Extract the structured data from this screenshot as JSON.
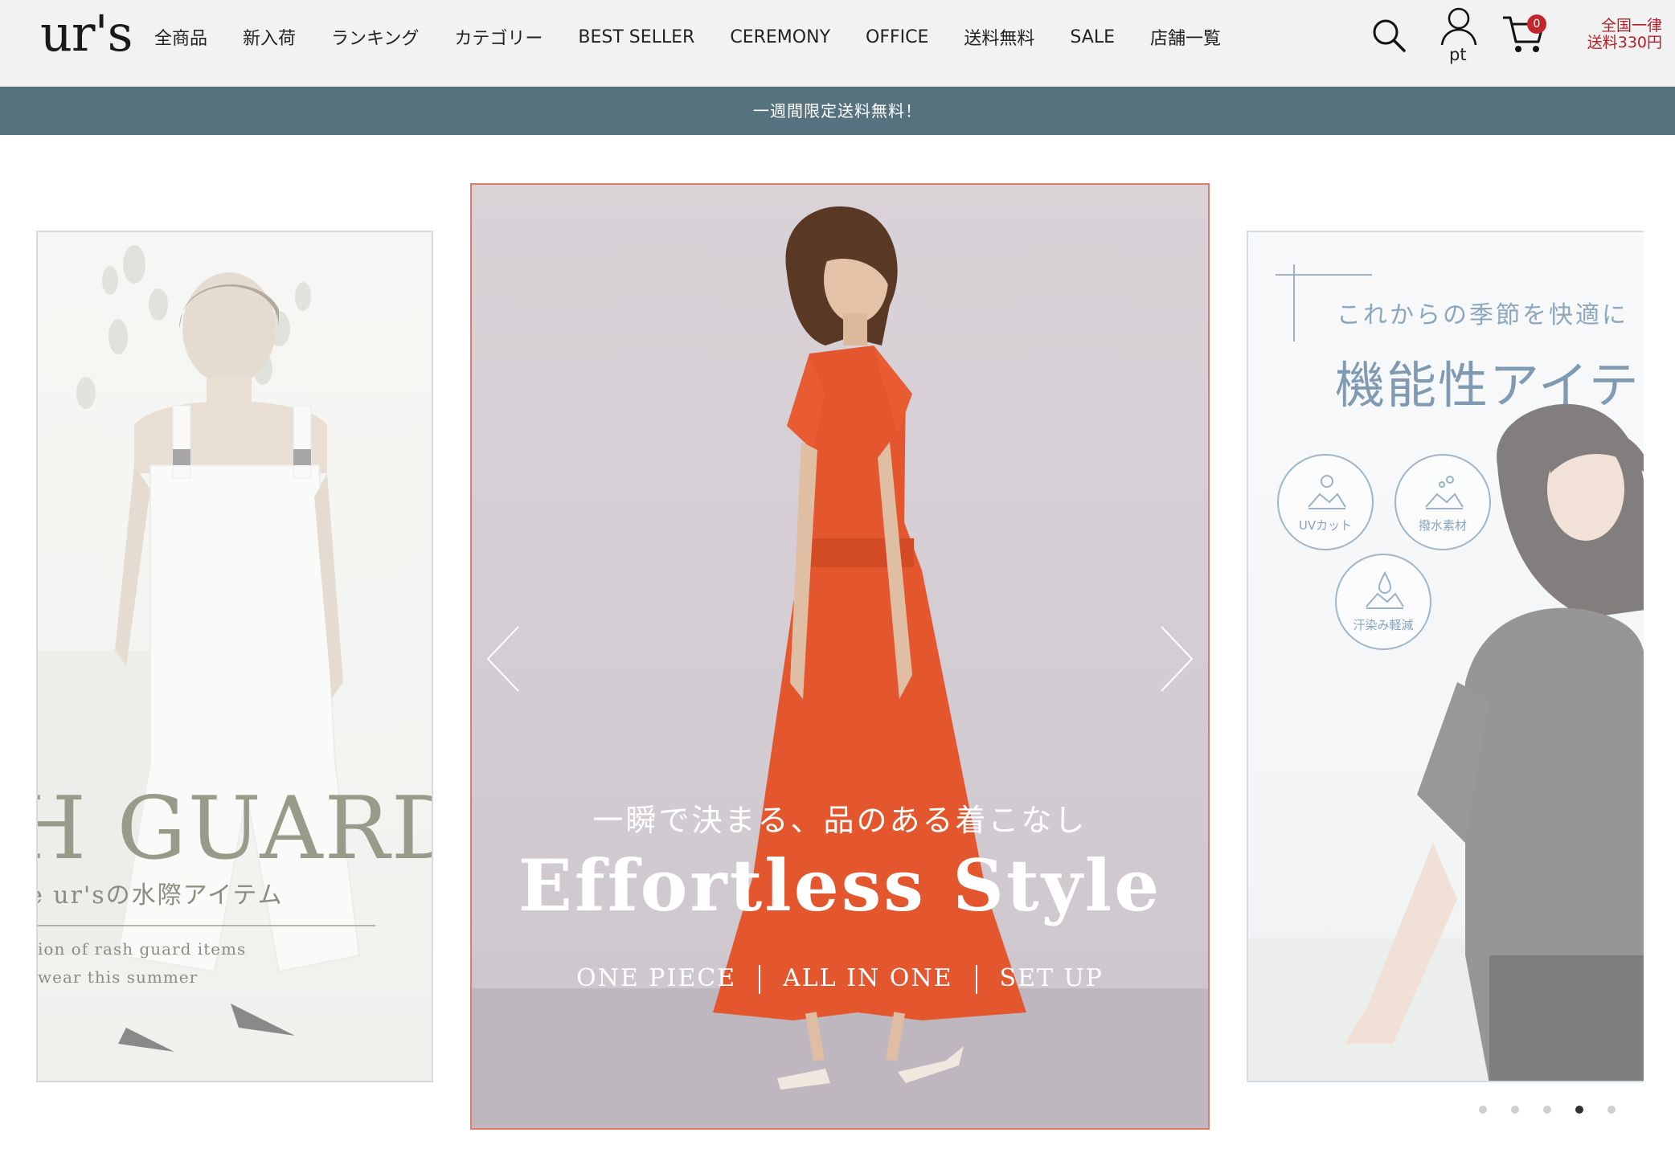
{
  "header": {
    "logo": "ur's",
    "nav": [
      "全商品",
      "新入荷",
      "ランキング",
      "カテゴリー",
      "BEST SELLER",
      "CEREMONY",
      "OFFICE",
      "送料無料",
      "SALE",
      "店舗一覧"
    ],
    "points_label": "pt",
    "cart_count": "0",
    "shipping_line1": "全国一律",
    "shipping_line2": "送料330円"
  },
  "promo": {
    "text": "一週間限定送料無料！"
  },
  "carousel": {
    "left": {
      "title": "H GUARD",
      "subtitle": "e ur'sの水際アイテム",
      "en_line1": "ion of rash guard items",
      "en_line2": "wear this summer"
    },
    "center": {
      "catch": "一瞬で決まる、品のある着こなし",
      "title": "Effortless Style",
      "categories": [
        "ONE PIECE",
        "ALL IN ONE",
        "SET UP"
      ]
    },
    "right": {
      "lead": "これからの季節を快適に",
      "title": "機能性アイテ",
      "badges": [
        "UVカット",
        "撥水素材",
        "汗染み軽減"
      ]
    },
    "dot_count": 5,
    "active_dot": 4
  },
  "colors": {
    "promo_bg": "#56727f",
    "accent_red": "#b3202a",
    "dress": "#e4562e"
  }
}
